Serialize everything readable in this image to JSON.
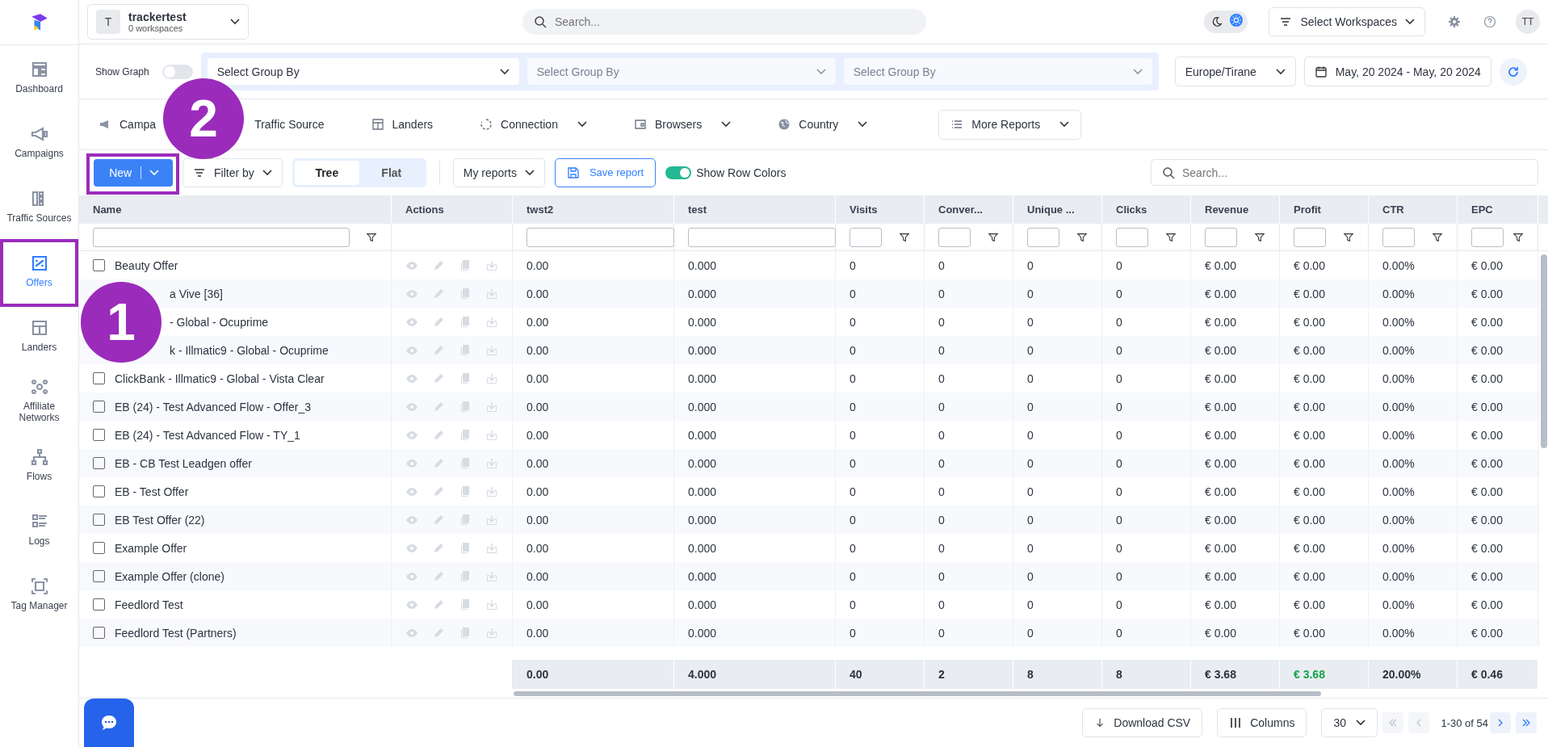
{
  "workspace": {
    "initial": "T",
    "name": "trackertest",
    "count": "0 workspaces"
  },
  "search": {
    "placeholder": "Search..."
  },
  "theme": {
    "light": true
  },
  "workspaces_button": "Select Workspaces",
  "avatar": "TT",
  "sidebar": {
    "items": [
      {
        "label": "Dashboard",
        "selected": false
      },
      {
        "label": "Campaigns",
        "selected": false
      },
      {
        "label": "Traffic Sources",
        "selected": false
      },
      {
        "label": "Offers",
        "selected": true
      },
      {
        "label": "Landers",
        "selected": false
      },
      {
        "label": "Affiliate Networks",
        "selected": false
      },
      {
        "label": "Flows",
        "selected": false
      },
      {
        "label": "Logs",
        "selected": false
      },
      {
        "label": "Tag Manager",
        "selected": false
      }
    ]
  },
  "group_bar": {
    "show_graph": {
      "label": "Show Graph",
      "on": false
    },
    "group_by": [
      {
        "text": "Select Group By",
        "filled": true
      },
      {
        "text": "Select Group By",
        "filled": false
      },
      {
        "text": "Select Group By",
        "filled": false
      }
    ],
    "timezone": "Europe/Tirane",
    "date_range": "May, 20 2024 - May, 20 2024"
  },
  "report_tabs": [
    {
      "label": "Campa",
      "kind": "tab",
      "dropdown": false
    },
    {
      "label": "Traffic Source",
      "kind": "tab",
      "dropdown": false
    },
    {
      "label": "Landers",
      "kind": "tab",
      "dropdown": false
    },
    {
      "label": "Connection",
      "kind": "tab",
      "dropdown": true
    },
    {
      "label": "Browsers",
      "kind": "tab",
      "dropdown": true
    },
    {
      "label": "Country",
      "kind": "tab",
      "dropdown": true
    },
    {
      "label": "More Reports",
      "kind": "button",
      "dropdown": true
    }
  ],
  "toolbar": {
    "new_button": "New",
    "filter_button": "Filter by",
    "view_modes": [
      {
        "label": "Tree",
        "selected": true
      },
      {
        "label": "Flat",
        "selected": false
      }
    ],
    "my_reports": "My reports",
    "save_report": "Save report",
    "row_colors": {
      "label": "Show Row Colors",
      "on": true
    },
    "search_placeholder": "Search..."
  },
  "annotations": [
    {
      "number": "1"
    },
    {
      "number": "2"
    }
  ],
  "table": {
    "columns": [
      {
        "label": "Name",
        "filterable": true
      },
      {
        "label": "Actions",
        "filterable": false
      },
      {
        "label": "twst2",
        "filterable": true
      },
      {
        "label": "test",
        "filterable": true
      },
      {
        "label": "Visits",
        "filterable": true
      },
      {
        "label": "Conver...",
        "filterable": true
      },
      {
        "label": "Unique ...",
        "filterable": true
      },
      {
        "label": "Clicks",
        "filterable": true
      },
      {
        "label": "Revenue",
        "filterable": true
      },
      {
        "label": "Profit",
        "filterable": true
      },
      {
        "label": "CTR",
        "filterable": true
      },
      {
        "label": "EPC",
        "filterable": true
      }
    ],
    "rows": [
      {
        "name": "Beauty Offer",
        "checked": false,
        "values": [
          "0.00",
          "0.000",
          "0",
          "0",
          "0",
          "0",
          "€ 0.00",
          "€ 0.00",
          "0.00%",
          "€ 0.00"
        ]
      },
      {
        "name": "a Vive [36]",
        "values": [
          "0.00",
          "0.000",
          "0",
          "0",
          "0",
          "0",
          "€ 0.00",
          "€ 0.00",
          "0.00%",
          "€ 0.00"
        ]
      },
      {
        "name": "- Global - Ocuprime",
        "values": [
          "0.00",
          "0.000",
          "0",
          "0",
          "0",
          "0",
          "€ 0.00",
          "€ 0.00",
          "0.00%",
          "€ 0.00"
        ]
      },
      {
        "name": "k - Illmatic9 - Global - Ocuprime",
        "values": [
          "0.00",
          "0.000",
          "0",
          "0",
          "0",
          "0",
          "€ 0.00",
          "€ 0.00",
          "0.00%",
          "€ 0.00"
        ]
      },
      {
        "name": "ClickBank - Illmatic9 - Global - Vista Clear",
        "checked": false,
        "values": [
          "0.00",
          "0.000",
          "0",
          "0",
          "0",
          "0",
          "€ 0.00",
          "€ 0.00",
          "0.00%",
          "€ 0.00"
        ]
      },
      {
        "name": "EB (24) - Test Advanced Flow - Offer_3",
        "checked": false,
        "values": [
          "0.00",
          "0.000",
          "0",
          "0",
          "0",
          "0",
          "€ 0.00",
          "€ 0.00",
          "0.00%",
          "€ 0.00"
        ]
      },
      {
        "name": "EB (24) - Test Advanced Flow - TY_1",
        "checked": false,
        "values": [
          "0.00",
          "0.000",
          "0",
          "0",
          "0",
          "0",
          "€ 0.00",
          "€ 0.00",
          "0.00%",
          "€ 0.00"
        ]
      },
      {
        "name": "EB - CB Test Leadgen offer",
        "checked": false,
        "values": [
          "0.00",
          "0.000",
          "0",
          "0",
          "0",
          "0",
          "€ 0.00",
          "€ 0.00",
          "0.00%",
          "€ 0.00"
        ]
      },
      {
        "name": "EB - Test Offer",
        "checked": false,
        "values": [
          "0.00",
          "0.000",
          "0",
          "0",
          "0",
          "0",
          "€ 0.00",
          "€ 0.00",
          "0.00%",
          "€ 0.00"
        ]
      },
      {
        "name": "EB Test Offer (22)",
        "checked": false,
        "values": [
          "0.00",
          "0.000",
          "0",
          "0",
          "0",
          "0",
          "€ 0.00",
          "€ 0.00",
          "0.00%",
          "€ 0.00"
        ]
      },
      {
        "name": "Example Offer",
        "checked": false,
        "values": [
          "0.00",
          "0.000",
          "0",
          "0",
          "0",
          "0",
          "€ 0.00",
          "€ 0.00",
          "0.00%",
          "€ 0.00"
        ]
      },
      {
        "name": "Example Offer (clone)",
        "checked": false,
        "values": [
          "0.00",
          "0.000",
          "0",
          "0",
          "0",
          "0",
          "€ 0.00",
          "€ 0.00",
          "0.00%",
          "€ 0.00"
        ]
      },
      {
        "name": "Feedlord Test",
        "checked": false,
        "values": [
          "0.00",
          "0.000",
          "0",
          "0",
          "0",
          "0",
          "€ 0.00",
          "€ 0.00",
          "0.00%",
          "€ 0.00"
        ]
      },
      {
        "name": "Feedlord Test (Partners)",
        "checked": false,
        "values": [
          "0.00",
          "0.000",
          "0",
          "0",
          "0",
          "0",
          "€ 0.00",
          "€ 0.00",
          "0.00%",
          "€ 0.00"
        ]
      }
    ],
    "totals": [
      {
        "text": "0.00",
        "positive": false
      },
      {
        "text": "4.000",
        "positive": false
      },
      {
        "text": "40",
        "positive": false
      },
      {
        "text": "2",
        "positive": false
      },
      {
        "text": "8",
        "positive": false
      },
      {
        "text": "8",
        "positive": false
      },
      {
        "text": "€ 3.68",
        "positive": false
      },
      {
        "text": "€ 3.68",
        "positive": true
      },
      {
        "text": "20.00%",
        "positive": false
      },
      {
        "text": "€ 0.46",
        "positive": false
      }
    ]
  },
  "footer": {
    "download": "Download CSV",
    "columns": "Columns",
    "page_size": "30",
    "range": "1-30 of 54",
    "first_disabled": true,
    "prev_disabled": true,
    "next_disabled": false,
    "last_disabled": false
  }
}
